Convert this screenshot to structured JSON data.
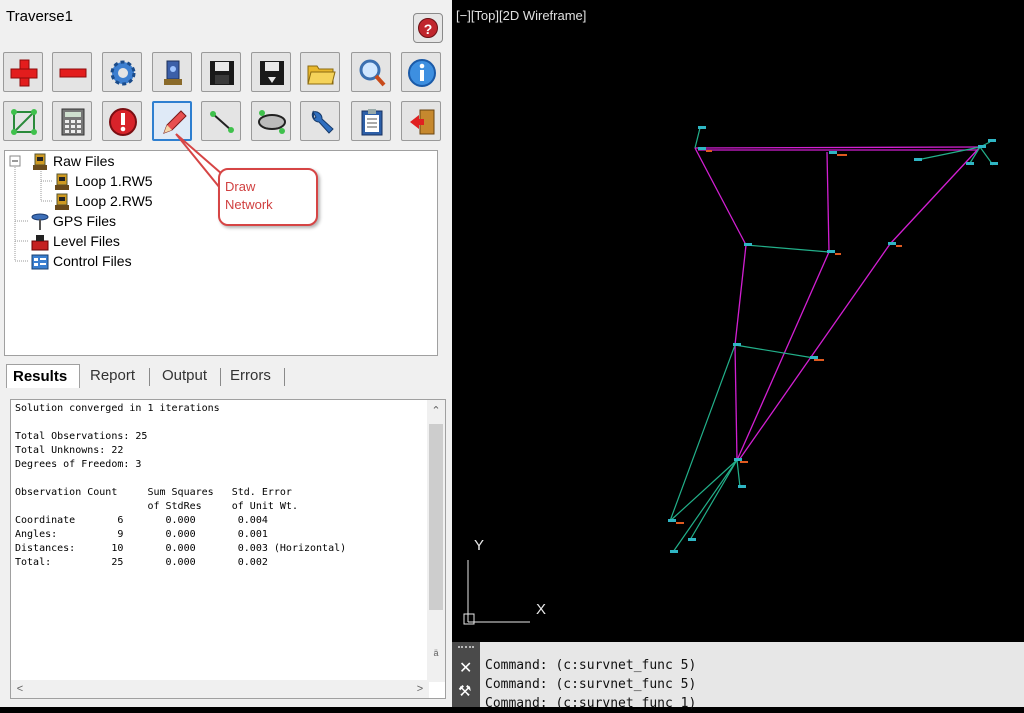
{
  "panel": {
    "title": "Traverse1"
  },
  "tree": {
    "items": [
      {
        "label": "Raw Files",
        "icon": "instrument-icon"
      },
      {
        "label": "Loop 1.RW5",
        "icon": "instrument-icon"
      },
      {
        "label": "Loop 2.RW5",
        "icon": "instrument-icon"
      },
      {
        "label": "GPS Files",
        "icon": "gps-icon"
      },
      {
        "label": "Level Files",
        "icon": "level-icon"
      },
      {
        "label": "Control Files",
        "icon": "control-icon"
      }
    ]
  },
  "callout": {
    "line1": "Draw",
    "line2": "Network"
  },
  "tabs": [
    "Results",
    "Report",
    "Output",
    "Errors"
  ],
  "results": {
    "text": "Solution converged in 1 iterations\n\nTotal Observations: 25\nTotal Unknowns: 22\nDegrees of Freedom: 3\n\nObservation Count     Sum Squares   Std. Error\n                      of StdRes     of Unit Wt.\nCoordinate       6       0.000       0.004\nAngles:          9       0.000       0.001\nDistances:      10       0.000       0.003 (Horizontal)\nTotal:          25       0.000       0.002"
  },
  "viewport": {
    "label": "[−][Top][2D Wireframe]",
    "axis_y": "Y",
    "axis_x": "X"
  },
  "command": {
    "lines": [
      "Command: (c:survnet_func 5)",
      "Command: (c:survnet_func 5)",
      "Command: (c:survnet_func 1)"
    ]
  },
  "colors": {
    "traverse_line": "#d21fd2",
    "observation_line": "#22b08a",
    "point_label": "#2fb6c4",
    "point_marker": "#e05a20",
    "callout_border": "#d64545"
  }
}
